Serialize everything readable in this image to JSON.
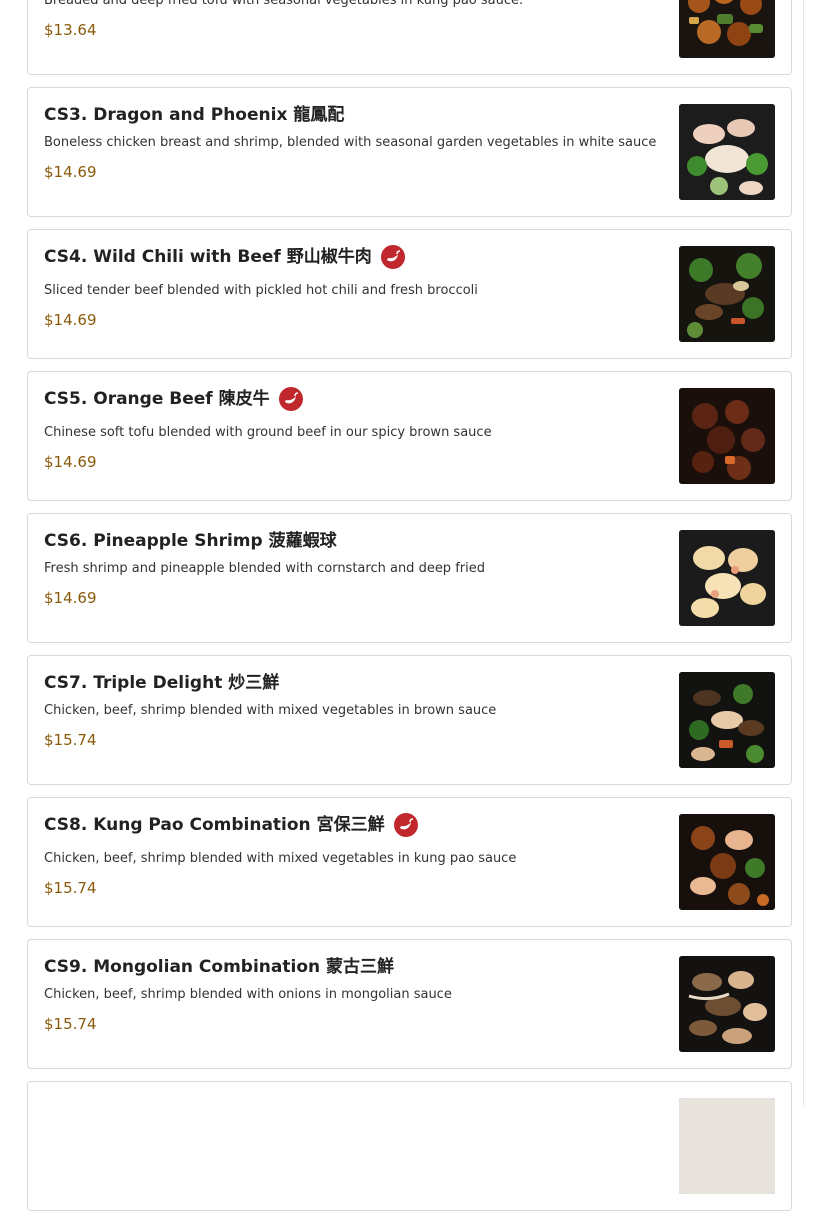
{
  "menu": {
    "items": [
      {
        "title": "",
        "description": "Breaded and deep fried tofu with seasonal vegetables in kung pao sauce.",
        "price": "$13.64",
        "spicy": false,
        "photo": "kung-pao-tofu-photo"
      },
      {
        "title": "CS3. Dragon and Phoenix 龍鳳配",
        "description": "Boneless chicken breast and shrimp, blended with seasonal garden vegetables in white sauce",
        "price": "$14.69",
        "spicy": false,
        "photo": "dragon-phoenix-photo"
      },
      {
        "title": "CS4. Wild Chili with Beef 野山椒牛肉",
        "description": "Sliced tender beef blended with pickled hot chili and fresh broccoli",
        "price": "$14.69",
        "spicy": true,
        "photo": "wild-chili-beef-photo"
      },
      {
        "title": "CS5. Orange Beef 陳皮牛",
        "description": "Chinese soft tofu blended with ground beef in our spicy brown sauce",
        "price": "$14.69",
        "spicy": true,
        "photo": "orange-beef-photo"
      },
      {
        "title": "CS6. Pineapple Shrimp 菠蘿蝦球",
        "description": "Fresh shrimp and pineapple blended with cornstarch and deep fried",
        "price": "$14.69",
        "spicy": false,
        "photo": "pineapple-shrimp-photo"
      },
      {
        "title": "CS7. Triple Delight 炒三鮮",
        "description": "Chicken, beef, shrimp blended with mixed vegetables in brown sauce",
        "price": "$15.74",
        "spicy": false,
        "photo": "triple-delight-photo"
      },
      {
        "title": "CS8. Kung Pao Combination 宮保三鮮",
        "description": "Chicken, beef, shrimp blended with mixed vegetables in kung pao sauce",
        "price": "$15.74",
        "spicy": true,
        "photo": "kung-pao-combination-photo"
      },
      {
        "title": "CS9. Mongolian Combination 蒙古三鮮",
        "description": "Chicken, beef, shrimp blended with onions in mongolian sauce",
        "price": "$15.74",
        "spicy": false,
        "photo": "mongolian-combination-photo"
      },
      {
        "title": "",
        "description": "",
        "price": "",
        "spicy": false,
        "photo": "next-item-photo"
      }
    ]
  },
  "colors": {
    "price": "#8a5a0a",
    "chili_badge": "#c0282d",
    "card_border": "#d9d9d9",
    "title": "#222222"
  },
  "icons": {
    "spicy": "chili-pepper-icon"
  }
}
